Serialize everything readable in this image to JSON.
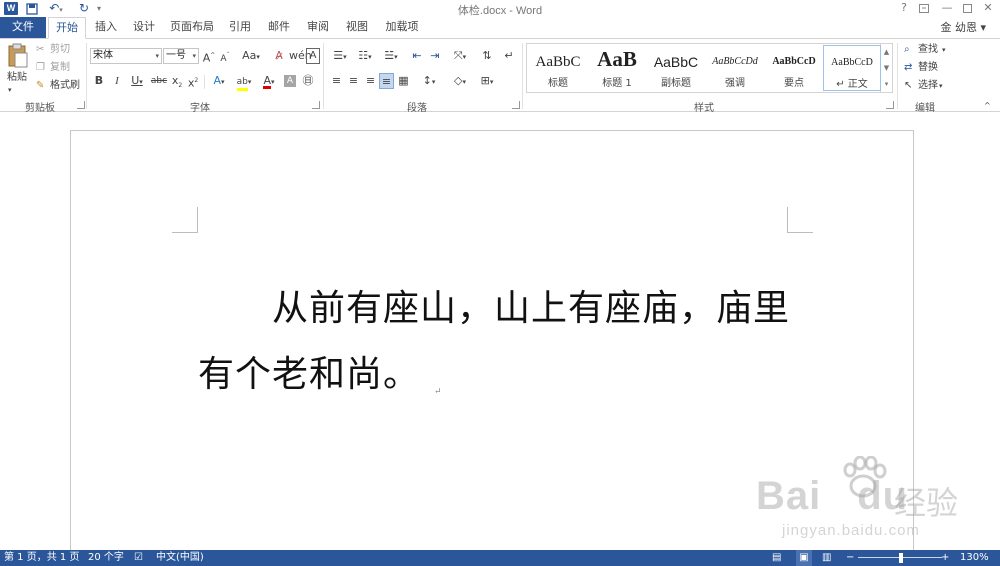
{
  "window": {
    "title": "体检.docx - Word",
    "help": "?",
    "user": "金 幼恩 ▾"
  },
  "tabs": [
    {
      "label": "文件"
    },
    {
      "label": "开始"
    },
    {
      "label": "插入"
    },
    {
      "label": "设计"
    },
    {
      "label": "页面布局"
    },
    {
      "label": "引用"
    },
    {
      "label": "邮件"
    },
    {
      "label": "审阅"
    },
    {
      "label": "视图"
    },
    {
      "label": "加载项"
    }
  ],
  "ribbon": {
    "clipboard": {
      "paste": "粘贴",
      "cut": "剪切",
      "copy": "复制",
      "format_painter": "格式刷",
      "label": "剪贴板"
    },
    "font": {
      "font_name": "宋体",
      "font_size": "一号",
      "change_case": "Aa",
      "label": "字体"
    },
    "paragraph": {
      "label": "段落"
    },
    "styles": {
      "label": "样式",
      "items": [
        {
          "sample": "AaBbC",
          "name": "标题"
        },
        {
          "sample": "AaB",
          "name": "标题 1"
        },
        {
          "sample": "AaBbC",
          "name": "副标题"
        },
        {
          "sample": "AaBbCcDd",
          "name": "强调"
        },
        {
          "sample": "AaBbCcD",
          "name": "要点"
        },
        {
          "sample": "AaBbCcD",
          "name": "↵ 正文"
        }
      ]
    },
    "editing": {
      "find": "查找",
      "replace": "替换",
      "select": "选择",
      "label": "编辑"
    }
  },
  "document": {
    "text": "从前有座山，山上有座庙，庙里有个老和尚。",
    "paragraph_mark": "↵"
  },
  "status": {
    "page": "第 1 页，共 1 页",
    "words": "20 个字",
    "language": "中文(中国)",
    "zoom": "130%",
    "zoom_minus": "−",
    "zoom_plus": "+"
  },
  "watermark": {
    "brand": "Bai",
    "brand_suffix": "du",
    "brand_cn": "经验",
    "url": "jingyan.baidu.com"
  },
  "colors": {
    "accent": "#2b579a",
    "highlight": "#ffff00",
    "font_color": "#e00000"
  }
}
